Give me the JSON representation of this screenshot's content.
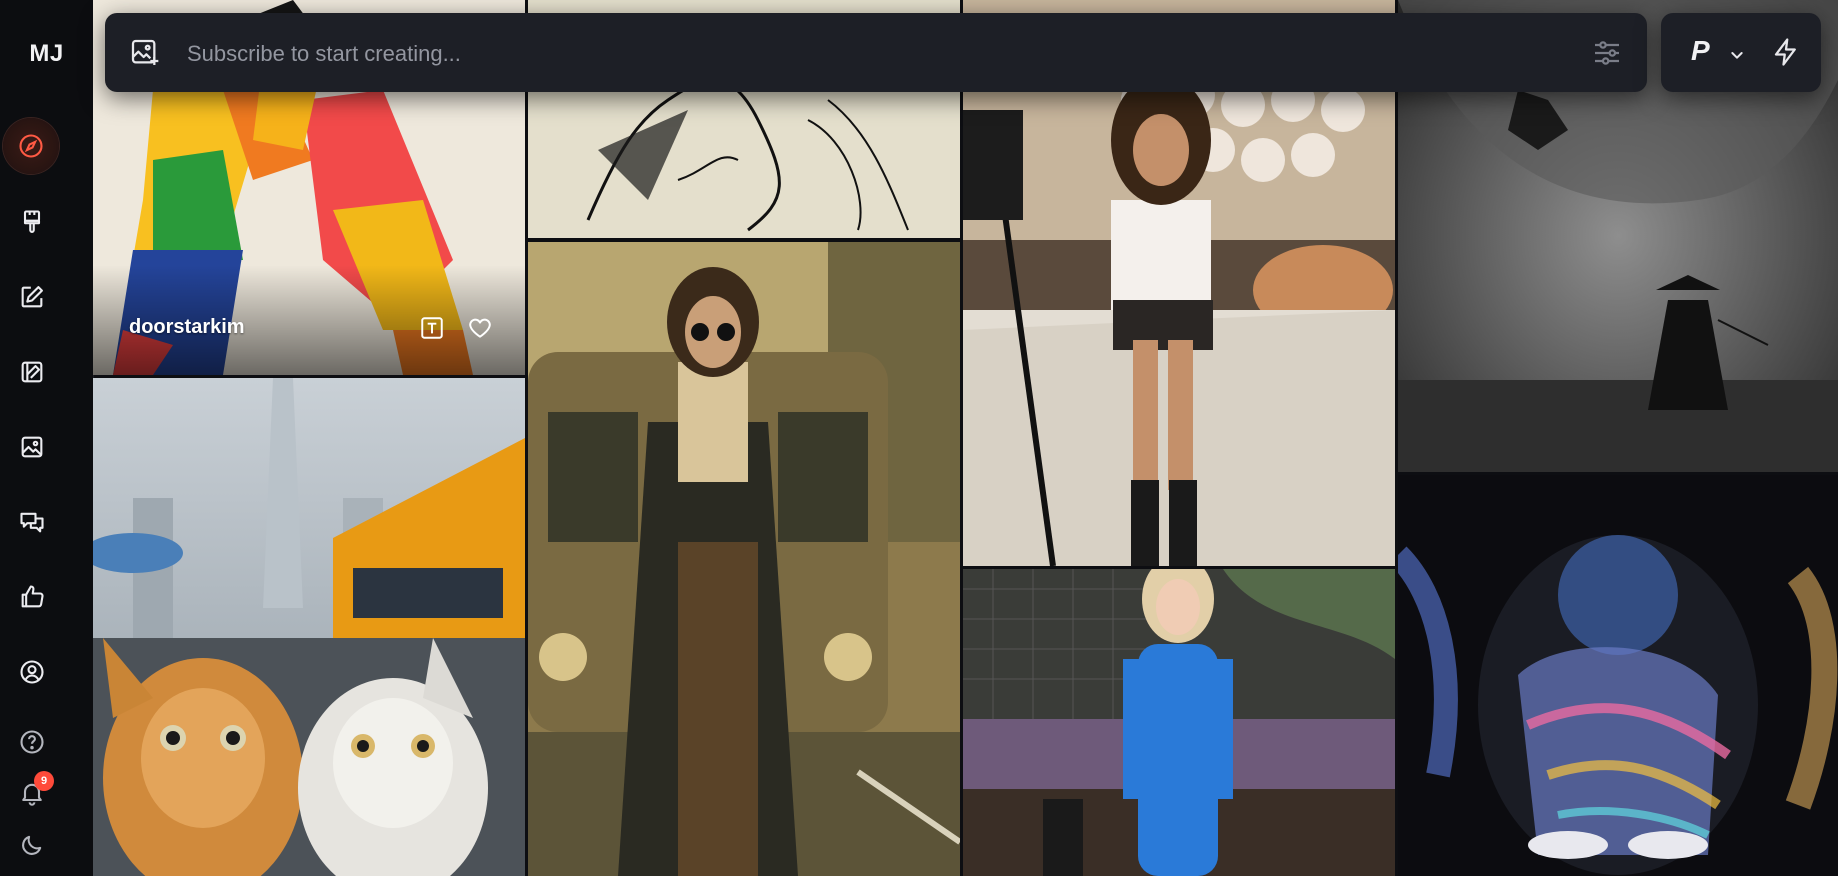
{
  "app": {
    "logo": "MJ"
  },
  "sidebar": {
    "items": [
      {
        "name": "explore",
        "icon": "compass-icon",
        "active": true
      },
      {
        "name": "create",
        "icon": "paintbrush-icon"
      },
      {
        "name": "edit",
        "icon": "edit-icon"
      },
      {
        "name": "personalize",
        "icon": "palette-icon"
      },
      {
        "name": "organize",
        "icon": "image-icon"
      },
      {
        "name": "chat",
        "icon": "chat-icon"
      },
      {
        "name": "tasks",
        "icon": "thumbs-up-icon"
      },
      {
        "name": "profile",
        "icon": "user-icon"
      }
    ],
    "bottom": [
      {
        "name": "help",
        "icon": "help-icon"
      },
      {
        "name": "notifications",
        "icon": "bell-icon",
        "badge": "9"
      },
      {
        "name": "theme",
        "icon": "moon-icon"
      }
    ]
  },
  "prompt": {
    "placeholder": "Subscribe to start creating..."
  },
  "mode": {
    "letter": "P"
  },
  "feed": {
    "hovered_tile": {
      "author": "doorstarkim"
    }
  },
  "colors": {
    "accent": "#ff4a3a",
    "panel": "#1d1f26",
    "background": "#0c0d10"
  }
}
